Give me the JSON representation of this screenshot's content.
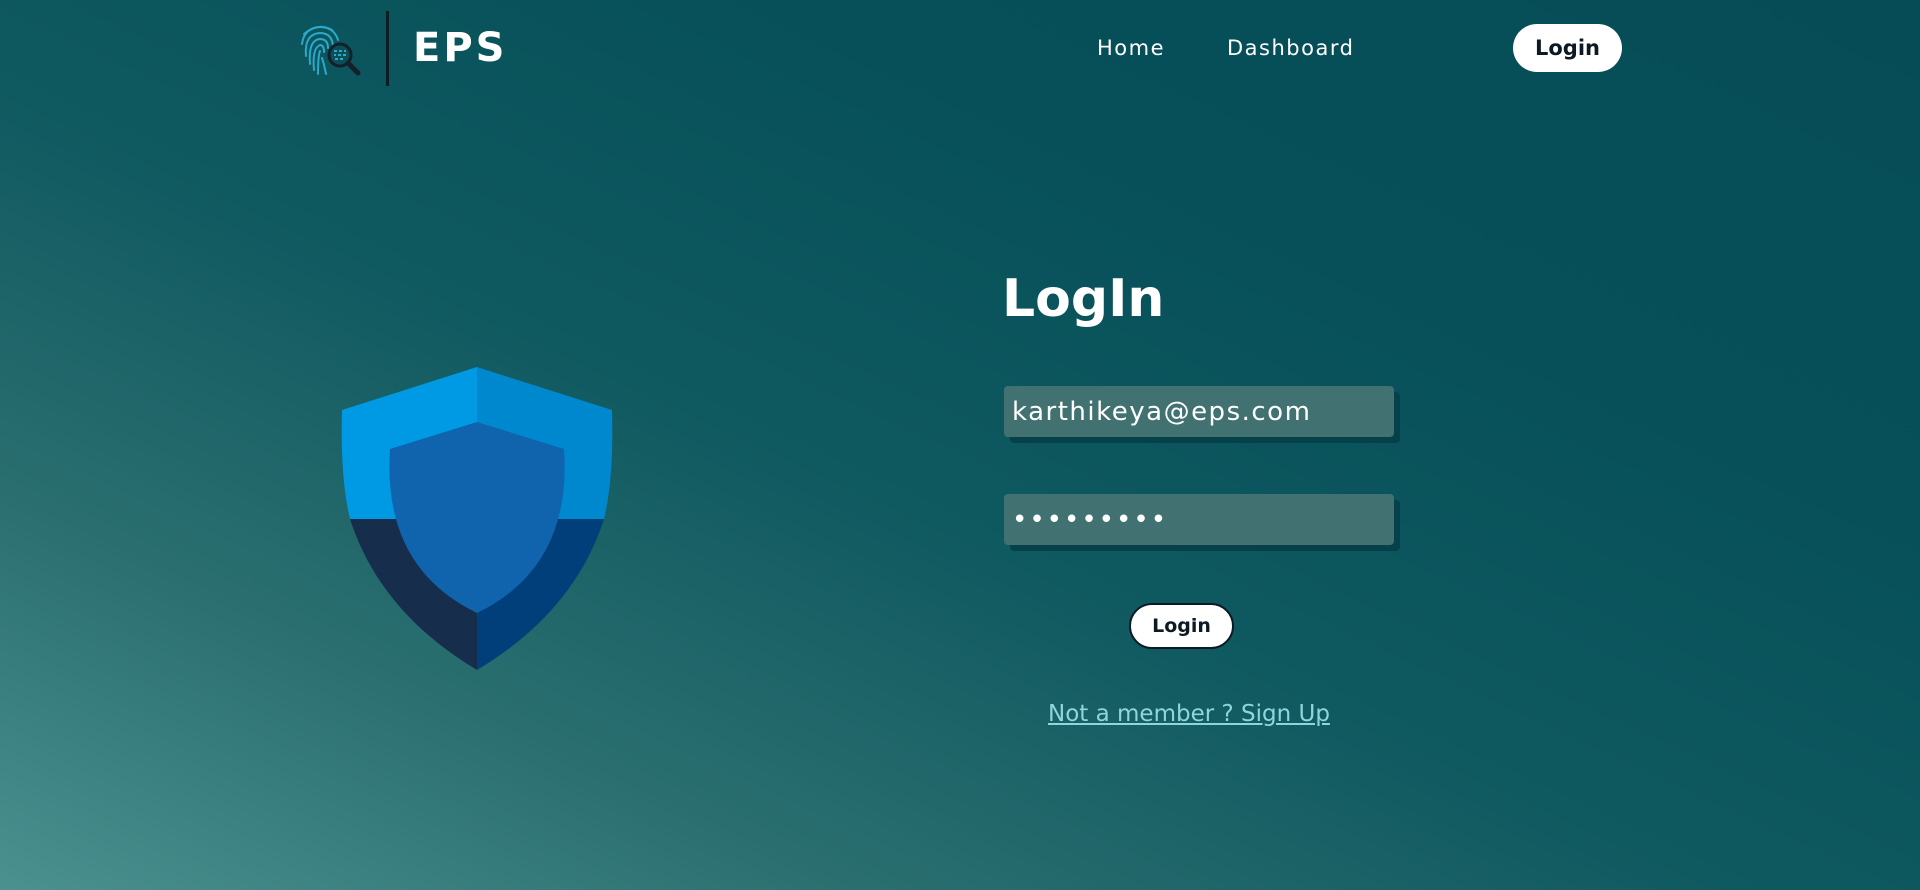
{
  "header": {
    "brand": "EPS",
    "logo_icon": "fingerprint-search-icon",
    "nav": [
      {
        "label": "Home"
      },
      {
        "label": "Dashboard"
      }
    ],
    "login_label": "Login"
  },
  "illustration": {
    "icon": "shield-icon",
    "colors": {
      "light_blue": "#009ae4",
      "mid_blue": "#0088cf",
      "inner_blue": "#1063ad",
      "dark_navy": "#162d4c",
      "dark_blue": "#003f79"
    }
  },
  "form": {
    "title": "LogIn",
    "email_value": "karthikeya@eps.com",
    "password_value": "•••••••••",
    "login_label": "Login",
    "signup_label": "Not a member ? Sign Up"
  },
  "theme": {
    "background_top": "#054c56",
    "background_bottom_left": "#4b9190",
    "field_bg": "#417171",
    "link_color": "#8fd6dc"
  }
}
